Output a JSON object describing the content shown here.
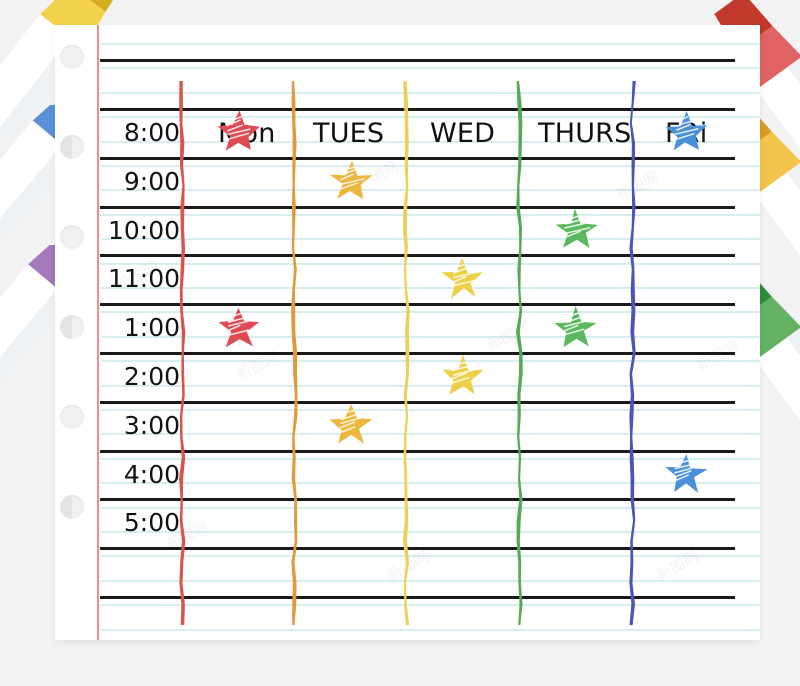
{
  "page": {
    "background_color": "#f2f2f2",
    "paper_color": "#ffffff",
    "margin_line_color": "#ef8b8b",
    "rule_line_color": "#d6eef0",
    "row_line_color": "#1a1a1a",
    "watermark_text": "新图网"
  },
  "schedule": {
    "day_headers": [
      {
        "label": "Mon",
        "color": "#e05a5f"
      },
      {
        "label": "TUES",
        "color": "#e8a049"
      },
      {
        "label": "WED",
        "color": "#edd060"
      },
      {
        "label": "THURS",
        "color": "#5cad5c"
      },
      {
        "label": "FRi",
        "color": "#5560c0"
      }
    ],
    "time_labels": [
      "8:00",
      "9:00",
      "10:00",
      "11:00",
      "1:00",
      "2:00",
      "3:00",
      "4:00",
      "5:00"
    ],
    "column_colors": [
      "#d9534f",
      "#e09a3e",
      "#ebd05a",
      "#57a857",
      "#4a55b8"
    ],
    "stars": [
      {
        "day": "Mon",
        "time": "8:00",
        "color": "#e04a55"
      },
      {
        "day": "FRi",
        "time": "8:00",
        "color": "#4a90d9"
      },
      {
        "day": "TUES",
        "time": "9:00",
        "color": "#edb63c"
      },
      {
        "day": "THURS",
        "time": "10:00",
        "color": "#5cb85c"
      },
      {
        "day": "WED",
        "time": "11:00",
        "color": "#edd04a"
      },
      {
        "day": "Mon",
        "time": "1:00",
        "color": "#e04a55"
      },
      {
        "day": "THURS",
        "time": "1:00",
        "color": "#5cb85c"
      },
      {
        "day": "WED",
        "time": "2:00",
        "color": "#edd04a"
      },
      {
        "day": "TUES",
        "time": "3:00",
        "color": "#edb63c"
      },
      {
        "day": "FRi",
        "time": "4:00",
        "color": "#4a90d9"
      }
    ]
  },
  "decor": {
    "markers_left": [
      {
        "name": "marker-yellow",
        "body_color": "#f2d14b",
        "tip_color": "#d4ae20"
      },
      {
        "name": "marker-blue",
        "body_color": "#5b90d8",
        "tip_color": "#2b72b8"
      },
      {
        "name": "marker-purple",
        "body_color": "#a478bb",
        "tip_color": "#7d3f96"
      }
    ],
    "markers_right": [
      {
        "name": "marker-red",
        "body_color": "#e06262",
        "tip_color": "#c0392b"
      },
      {
        "name": "marker-orange",
        "body_color": "#f2c44b",
        "tip_color": "#d99a20"
      },
      {
        "name": "marker-green",
        "body_color": "#63b263",
        "tip_color": "#2f8c3b"
      }
    ],
    "binder_holes_count": 6
  }
}
